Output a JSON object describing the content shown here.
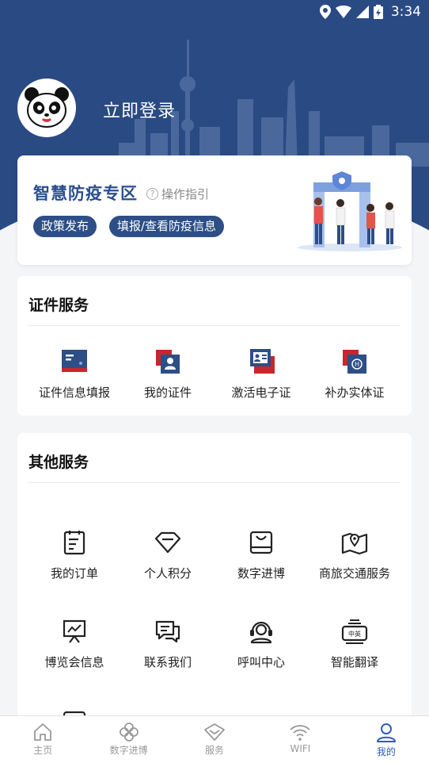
{
  "status_bar": {
    "time": "3:34"
  },
  "profile": {
    "login_text": "立即登录"
  },
  "epidemic": {
    "title": "智慧防疫专区",
    "guide_label": "操作指引",
    "guide_icon": "?",
    "tags": [
      "政策发布",
      "填报/查看防疫信息"
    ]
  },
  "certificate_services": {
    "title": "证件服务",
    "items": [
      {
        "label": "证件信息填报",
        "icon": "id-form-icon"
      },
      {
        "label": "我的证件",
        "icon": "id-card-icon"
      },
      {
        "label": "激活电子证",
        "icon": "e-certificate-icon"
      },
      {
        "label": "补办实体证",
        "icon": "reissue-card-icon"
      }
    ]
  },
  "other_services": {
    "title": "其他服务",
    "items": [
      {
        "label": "我的订单",
        "icon": "order-icon"
      },
      {
        "label": "个人积分",
        "icon": "diamond-icon"
      },
      {
        "label": "数字进博",
        "icon": "digital-expo-icon"
      },
      {
        "label": "商旅交通服务",
        "icon": "map-pin-icon"
      },
      {
        "label": "博览会信息",
        "icon": "presentation-icon"
      },
      {
        "label": "联系我们",
        "icon": "chat-icon"
      },
      {
        "label": "呼叫中心",
        "icon": "headset-icon"
      },
      {
        "label": "智能翻译",
        "icon": "translate-icon"
      }
    ],
    "translate_badge": "中英"
  },
  "bottom_nav": {
    "items": [
      {
        "label": "主页",
        "icon": "home-icon"
      },
      {
        "label": "数字进博",
        "icon": "clover-icon"
      },
      {
        "label": "服务",
        "icon": "service-diamond-icon"
      },
      {
        "label": "WIFI",
        "icon": "wifi-icon"
      },
      {
        "label": "我的",
        "icon": "user-icon",
        "active": true
      }
    ]
  },
  "colors": {
    "brand": "#2a4a83",
    "accent_red": "#c8262c",
    "active_nav": "#2b5ec2"
  }
}
